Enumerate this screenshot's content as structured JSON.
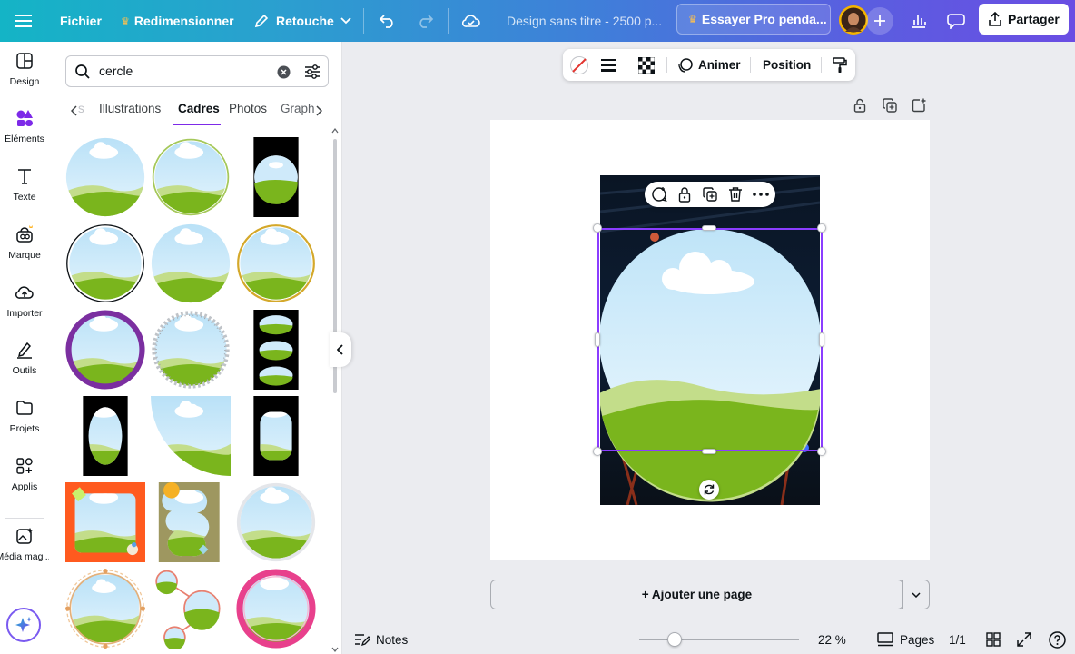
{
  "topbar": {
    "menu_icon": "hamburger-icon",
    "file_label": "Fichier",
    "resize_label": "Redimensionner",
    "edit_label": "Retouche",
    "design_title": "Design sans titre - 2500 p...",
    "pro_label": "Essayer Pro penda...",
    "share_label": "Partager"
  },
  "rail": {
    "items": [
      {
        "label": "Design",
        "icon": "layout-icon"
      },
      {
        "label": "Éléments",
        "icon": "shapes-icon"
      },
      {
        "label": "Texte",
        "icon": "text-icon"
      },
      {
        "label": "Marque",
        "icon": "brand-icon"
      },
      {
        "label": "Importer",
        "icon": "upload-cloud-icon"
      },
      {
        "label": "Outils",
        "icon": "pen-tools-icon"
      },
      {
        "label": "Projets",
        "icon": "folder-icon"
      },
      {
        "label": "Applis",
        "icon": "apps-icon"
      },
      {
        "label": "Média magi...",
        "icon": "magic-media-icon"
      }
    ]
  },
  "panel": {
    "search_query": "cercle",
    "tabs": [
      {
        "label": "s"
      },
      {
        "label": "Illustrations"
      },
      {
        "label": "Cadres",
        "active": true
      },
      {
        "label": "Photos"
      },
      {
        "label": "Graph"
      }
    ]
  },
  "context_bar": {
    "animate_label": "Animer",
    "position_label": "Position"
  },
  "canvas": {
    "add_page_label": "+ Ajouter une page"
  },
  "bottombar": {
    "notes_label": "Notes",
    "zoom_label": "22 %",
    "zoom_level": 22,
    "pages_label": "Pages",
    "page_count": "1/1"
  },
  "colors": {
    "accent": "#8b3dff",
    "sky": "#cfeafa",
    "grass": "#7ab51d",
    "frame_purple": "#7b2fa0",
    "frame_pink": "#e8408c",
    "frame_orange": "#ff5a1f"
  }
}
